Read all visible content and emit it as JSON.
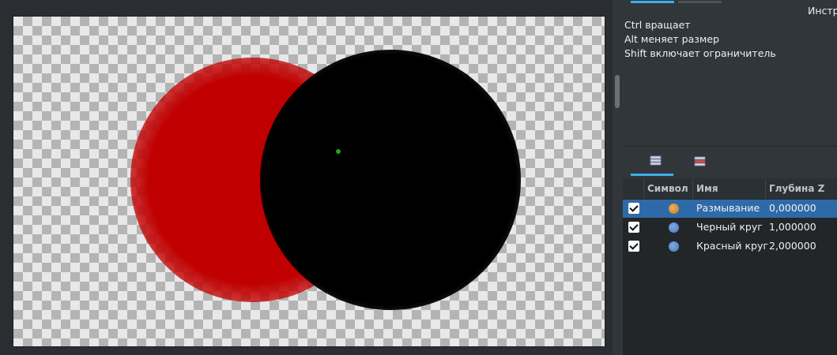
{
  "tool_panel": {
    "title": "Инстр",
    "hints": [
      "Ctrl вращает",
      "Alt меняет размер",
      "Shift включает ограничитель"
    ]
  },
  "layers": {
    "tabs": [
      {
        "icon": "layers-icon"
      },
      {
        "icon": "layers-edit-icon"
      }
    ],
    "columns": [
      "Символ",
      "Имя",
      "Глубина Z"
    ],
    "rows": [
      {
        "name": "Размывание",
        "depth": "0,000000",
        "symbol_color": "#d9923a",
        "checked": true,
        "selected": true
      },
      {
        "name": "Черный круг",
        "depth": "1,000000",
        "symbol_color": "#5b86c9",
        "checked": true,
        "selected": false
      },
      {
        "name": "Красный круг",
        "depth": "2,000000",
        "symbol_color": "#5b86c9",
        "checked": true,
        "selected": false
      }
    ]
  },
  "colors": {
    "accent": "#3daee9",
    "selection": "#2f6aa8",
    "red_circle": "#c00000",
    "black_circle": "#000000",
    "origin_dot": "#1fa81f"
  }
}
